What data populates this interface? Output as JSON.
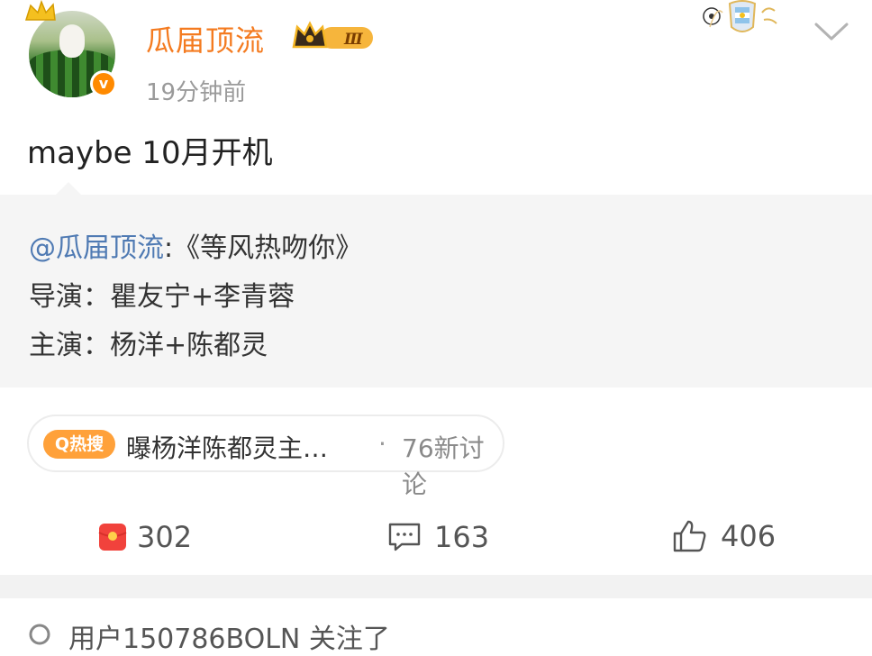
{
  "header": {
    "username": "瓜届顶流",
    "level_badge": "Ⅲ",
    "timestamp": "19分钟前",
    "verified_mark": "v"
  },
  "post": {
    "text": "maybe 10月开机"
  },
  "repost": {
    "mention": "@瓜届顶流",
    "title_line": ":《等风热吻你》",
    "director_line": "导演：瞿友宁+李青蓉",
    "cast_line": "主演：杨洋+陈都灵"
  },
  "hot_search": {
    "tag": "Q热搜",
    "title": "曝杨洋陈都灵主…",
    "separator": "·",
    "discussion": "76新讨论"
  },
  "actions": {
    "repost_count": "302",
    "comment_count": "163",
    "like_count": "406"
  },
  "footer": {
    "text": "用户150786BOLN 关注了"
  },
  "colors": {
    "username": "#f47b20",
    "mention": "#4f7ab3",
    "hot_tag": "#ffa13a",
    "repost_bg": "#f5f5f5"
  },
  "icons": {
    "avatar": "watermelon-cat-avatar",
    "verified": "verified-badge-icon",
    "level": "crown-level-icon",
    "fan_badge": "football-argentina-badge",
    "chevron": "chevron-down-icon",
    "repost": "red-envelope-repost-icon",
    "comment": "comment-icon",
    "like": "thumbs-up-icon"
  }
}
